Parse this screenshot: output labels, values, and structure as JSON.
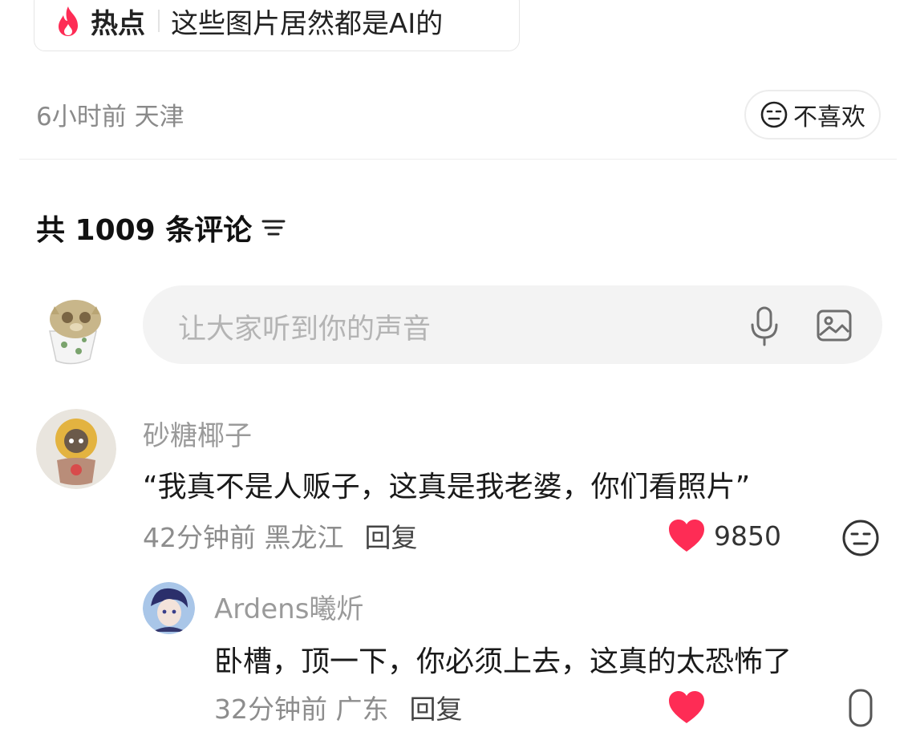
{
  "hot_topic": {
    "badge": "热点",
    "title": "这些图片居然都是AI的"
  },
  "post_meta": {
    "time_location": "6小时前 天津",
    "dislike_label": "不喜欢"
  },
  "comments_header": {
    "count_label": "共 1009 条评论"
  },
  "composer": {
    "placeholder": "让大家听到你的声音"
  },
  "comments": [
    {
      "username": "砂糖椰子",
      "text": "“我真不是人贩子，这真是我老婆，你们看照片”",
      "time_location": "42分钟前 黑龙江",
      "reply_label": "回复",
      "likes": "9850"
    },
    {
      "username": "Ardens曦炘",
      "text": "卧槽，顶一下，你必须上去，这真的太恐怖了",
      "time_location": "32分钟前 广东",
      "reply_label": "回复"
    }
  ],
  "colors": {
    "accent_red": "#fe2c55",
    "muted_text": "#8d8d8d",
    "input_bg": "#f3f3f3"
  }
}
